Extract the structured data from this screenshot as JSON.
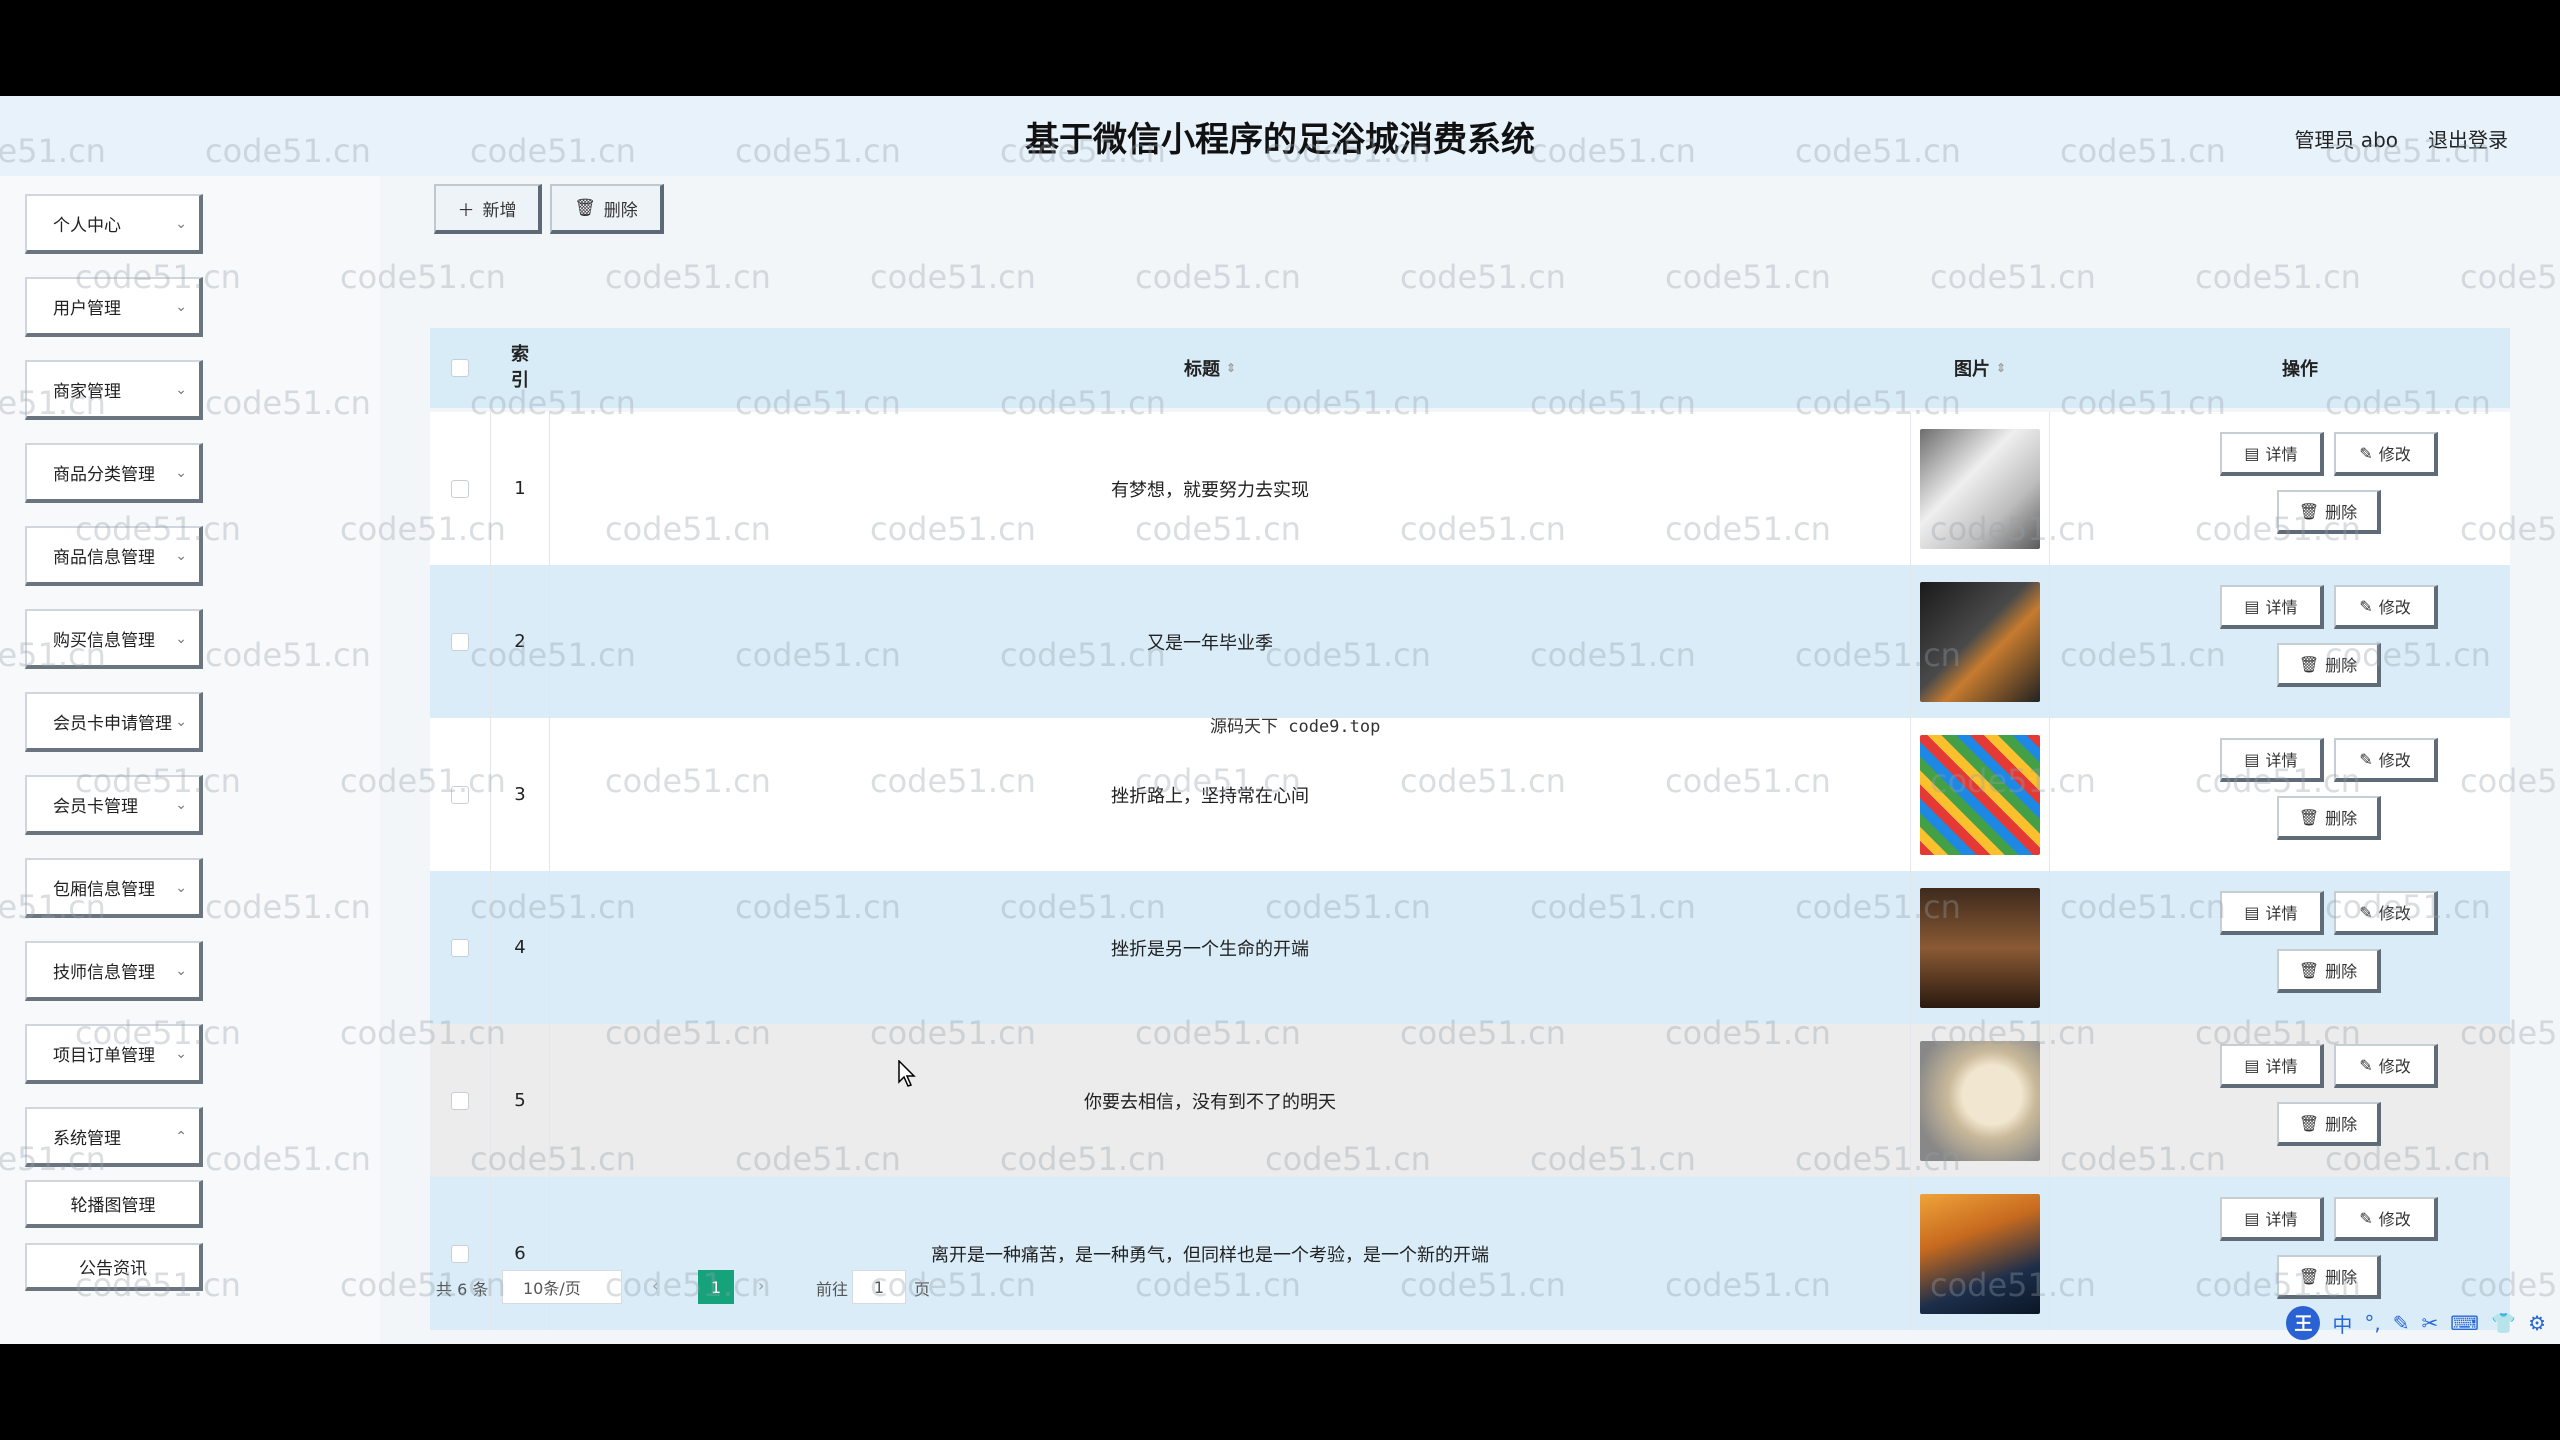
{
  "app": {
    "title": "基于微信小程序的足浴城消费系统",
    "user_label": "管理员 abo",
    "logout_label": "退出登录"
  },
  "sidebar": {
    "items": [
      {
        "label": "个人中心"
      },
      {
        "label": "用户管理"
      },
      {
        "label": "商家管理"
      },
      {
        "label": "商品分类管理"
      },
      {
        "label": "商品信息管理"
      },
      {
        "label": "购买信息管理"
      },
      {
        "label": "会员卡申请管理"
      },
      {
        "label": "会员卡管理"
      },
      {
        "label": "包厢信息管理"
      },
      {
        "label": "技师信息管理"
      },
      {
        "label": "项目订单管理"
      },
      {
        "label": "系统管理"
      }
    ],
    "sub_items": [
      {
        "label": "轮播图管理"
      },
      {
        "label": "公告资讯"
      }
    ]
  },
  "toolbar": {
    "add_label": "新增",
    "delete_label": "删除"
  },
  "table": {
    "headers": {
      "index": "索\n引",
      "title": "标题",
      "image": "图片",
      "actions": "操作"
    },
    "rows": [
      {
        "index": "1",
        "title": "有梦想，就要努力去实现",
        "image": "white-sofa"
      },
      {
        "index": "2",
        "title": "又是一年毕业季",
        "image": "microwave-oven"
      },
      {
        "index": "3",
        "title": "挫折路上，坚持常在心间",
        "image": "colorful-snacks"
      },
      {
        "index": "4",
        "title": "挫折是另一个生命的开端",
        "image": "living-room"
      },
      {
        "index": "5",
        "title": "你要去相信，没有到不了的明天",
        "image": "oat-grains"
      },
      {
        "index": "6",
        "title": "离开是一种痛苦，是一种勇气，但同样也是一个考验，是一个新的开端",
        "image": "kayak-sunset"
      }
    ],
    "action_labels": {
      "detail": "详情",
      "edit": "修改",
      "delete": "删除"
    }
  },
  "overlay_text": "源码天下 code9.top",
  "pager": {
    "total": "共 6 条",
    "page_size": "10条/页",
    "current_page": "1",
    "goto_prefix": "前往",
    "goto_value": "1",
    "goto_suffix": "页"
  },
  "watermark": "code51.cn",
  "tray": {
    "ime_label": "王",
    "lang_label": "中"
  }
}
